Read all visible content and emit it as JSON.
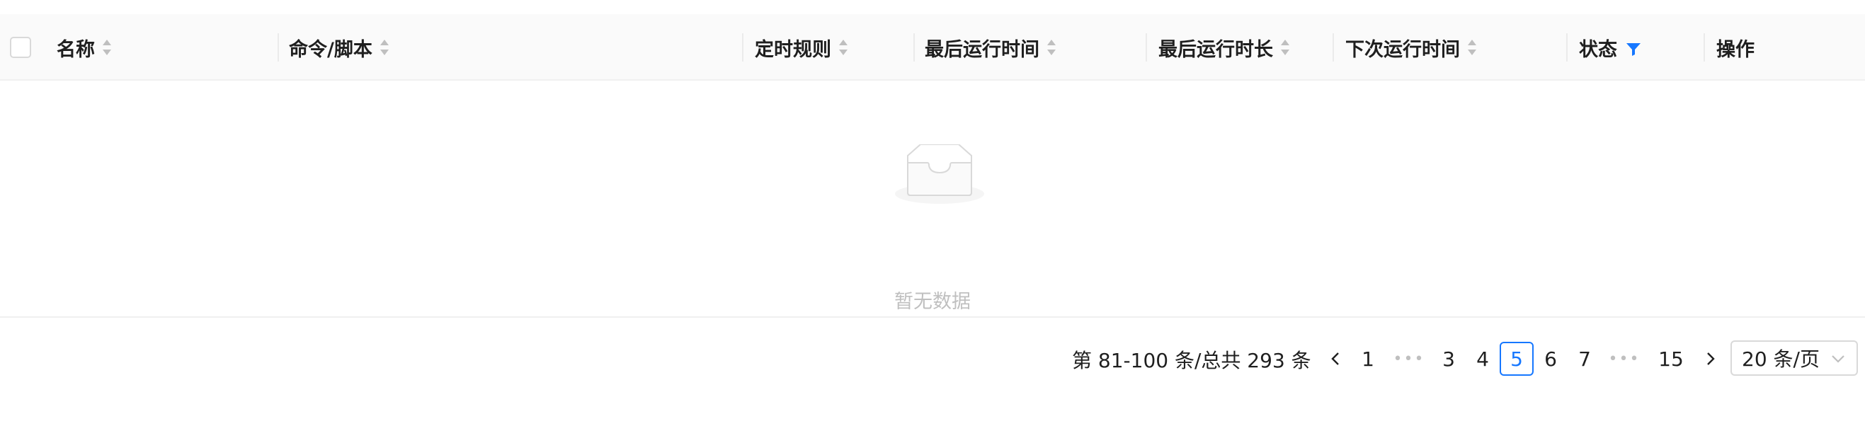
{
  "table": {
    "columns": [
      {
        "label": "名称",
        "sortable": true
      },
      {
        "label": "命令/脚本",
        "sortable": true
      },
      {
        "label": "定时规则",
        "sortable": true
      },
      {
        "label": "最后运行时间",
        "sortable": true
      },
      {
        "label": "最后运行时长",
        "sortable": true
      },
      {
        "label": "下次运行时间",
        "sortable": true
      },
      {
        "label": "状态",
        "filterable": true
      },
      {
        "label": "操作"
      }
    ],
    "empty_text": "暂无数据"
  },
  "pagination": {
    "total_text": "第 81-100 条/总共 293 条",
    "pages": [
      "1",
      "3",
      "4",
      "5",
      "6",
      "7",
      "15"
    ],
    "current_page": "5",
    "page_size": "20 条/页"
  },
  "colors": {
    "accent": "#1677ff",
    "header_bg": "#fafafa",
    "border": "#f0f0f0"
  }
}
